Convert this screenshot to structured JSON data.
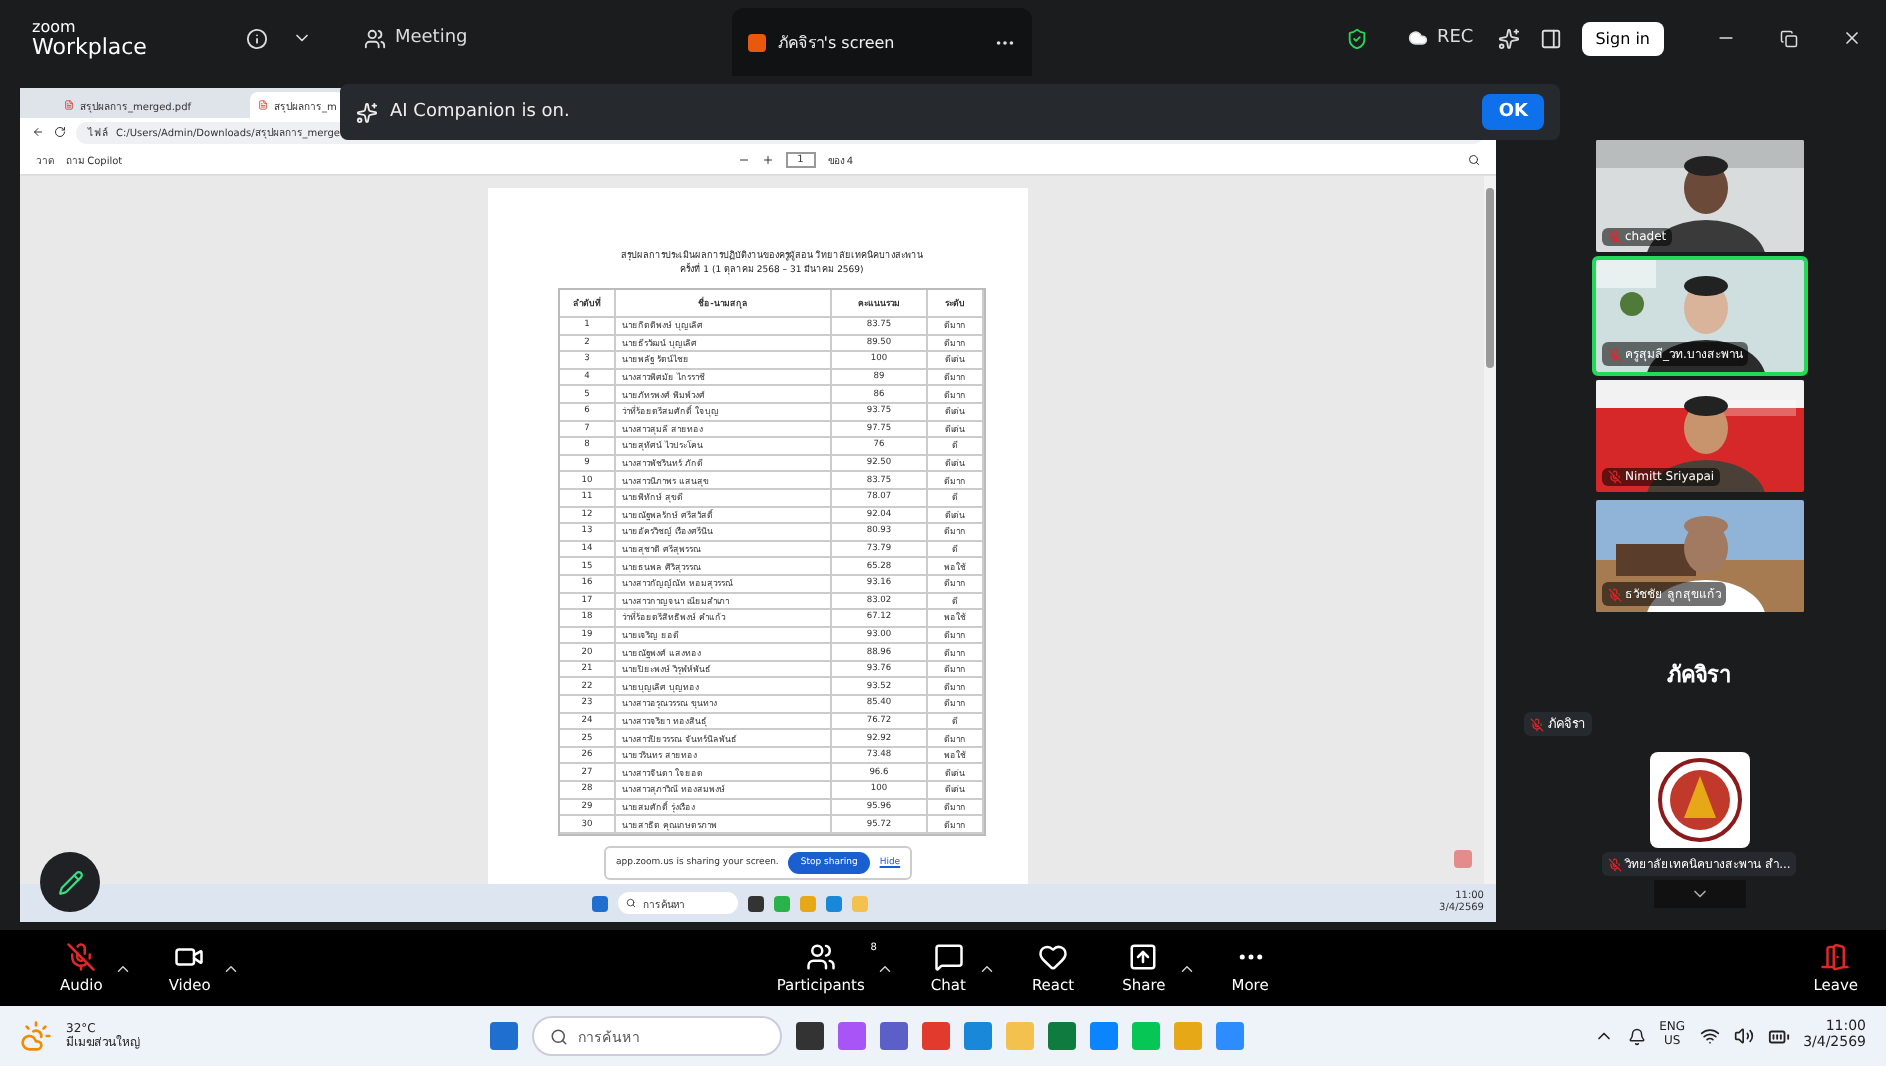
{
  "top_bar": {
    "logo_top": "zoom",
    "logo_bottom": "Workplace",
    "meeting_label": "Meeting",
    "share_tab": "ภัคจิรา's screen",
    "rec_label": "REC",
    "sign_in": "Sign in"
  },
  "ai_banner": {
    "message": "AI Companion is on.",
    "button": "OK"
  },
  "shared_screen": {
    "browser_tabs": [
      {
        "title": "สรุปผลการ_merged.pdf",
        "selected": false
      },
      {
        "title": "สรุปผลการ_m",
        "selected": true
      }
    ],
    "address": {
      "scheme": "ไฟล์",
      "path": "C:/Users/Admin/Downloads/สรุปผลการ_merge"
    },
    "pdf_toolbar": {
      "draw": "วาด",
      "copilot": "ถาม Copilot",
      "page": "1",
      "page_total": "ของ 4"
    },
    "document": {
      "title": "สรุปผลการประเมินผลการปฏิบัติงานของครูผู้สอน วิทยาลัยเทคนิคบางสะพาน",
      "subtitle": "ครั้งที่ 1 (1 ตุลาคม 2568 – 31 มีนาคม 2569)",
      "columns": [
        "ลำดับที่",
        "ชื่อ-นามสกุล",
        "คะแนนรวม",
        "ระดับ"
      ],
      "rows": [
        [
          "1",
          "นายกิตติพงษ์ บุญเลิศ",
          "83.75",
          "ดีมาก"
        ],
        [
          "2",
          "นายธีรวัฒน์ บุญเลิศ",
          "89.50",
          "ดีมาก"
        ],
        [
          "3",
          "นายพลัฐ รัตน์ไชย",
          "100",
          "ดีเด่น"
        ],
        [
          "4",
          "นางสาวพิศมัย ไกรราชี",
          "89",
          "ดีมาก"
        ],
        [
          "5",
          "นายภัทรพงศ์ พิมพ์วงศ์",
          "86",
          "ดีมาก"
        ],
        [
          "6",
          "ว่าที่ร้อยตรีสมศักดิ์ ใจบุญ",
          "93.75",
          "ดีเด่น"
        ],
        [
          "7",
          "นางสาวสุมลี สายทอง",
          "97.75",
          "ดีเด่น"
        ],
        [
          "8",
          "นายสุทัศน์ ไวประโคน",
          "76",
          "ดี"
        ],
        [
          "9",
          "นางสาวพัชรินทร์ ภักดี",
          "92.50",
          "ดีเด่น"
        ],
        [
          "10",
          "นางสาวนิภาพร แสนสุข",
          "83.75",
          "ดีมาก"
        ],
        [
          "11",
          "นายพิทักษ์ สุขดี",
          "78.07",
          "ดี"
        ],
        [
          "12",
          "นายณัฐพลรักษ์ ศรีสวัสดิ์",
          "92.04",
          "ดีเด่น"
        ],
        [
          "13",
          "นายอัครวิชญ์ เรืองศรีนิน",
          "80.93",
          "ดีมาก"
        ],
        [
          "14",
          "นายสุชาติ ศรีสุพรรณ",
          "73.79",
          "ดี"
        ],
        [
          "15",
          "นายธนพล ศิริสุวรรณ",
          "65.28",
          "พอใช้"
        ],
        [
          "16",
          "นางสาวกัญญ์ณัท หอมสุวรรณ์",
          "93.16",
          "ดีมาก"
        ],
        [
          "17",
          "นางสาวกาญจนา เนียมสำเภา",
          "83.02",
          "ดี"
        ],
        [
          "18",
          "ว่าที่ร้อยตรีสิทธิพงษ์ คำแก้ว",
          "67.12",
          "พอใช้"
        ],
        [
          "19",
          "นายเจริญ ยอดี",
          "93.00",
          "ดีมาก"
        ],
        [
          "20",
          "นายณัฐพงศ์ แสงทอง",
          "88.96",
          "ดีมาก"
        ],
        [
          "21",
          "นายปิยะพงษ์ วิรุฬห์พันธ์",
          "93.76",
          "ดีมาก"
        ],
        [
          "22",
          "นายบุญเลิศ บุญทอง",
          "93.52",
          "ดีมาก"
        ],
        [
          "23",
          "นางสาวอรุณวรรณ ขุนทาง",
          "85.40",
          "ดีมาก"
        ],
        [
          "24",
          "นางสาวจริยา ทองสินธุ์",
          "76.72",
          "ดี"
        ],
        [
          "25",
          "นางสาวปิยวรรณ จันทร์นิลพันธ์",
          "92.92",
          "ดีมาก"
        ],
        [
          "26",
          "นายวรินทร สายทอง",
          "73.48",
          "พอใช้"
        ],
        [
          "27",
          "นางสาวจินดา ใจยอด",
          "96.6",
          "ดีเด่น"
        ],
        [
          "28",
          "นางสาวสุภาวิณี ทองสมพงษ์",
          "100",
          "ดีเด่น"
        ],
        [
          "29",
          "นายสมศักดิ์ รุ่งเรือง",
          "95.96",
          "ดีมาก"
        ],
        [
          "30",
          "นายสาธิต คุณเกษตรภาพ",
          "95.72",
          "ดีมาก"
        ]
      ]
    },
    "sharing_bar": {
      "message": "app.zoom.us is sharing your screen.",
      "stop": "Stop sharing",
      "hide": "Hide"
    },
    "taskbar": {
      "search": "การค้นหา",
      "time": "11:00",
      "date": "3/4/2569"
    }
  },
  "gallery": {
    "tiles": [
      {
        "name": "chadet",
        "muted": true,
        "speaking": false
      },
      {
        "name": "ครูสุมลี_วท.บางสะพาน",
        "muted": true,
        "speaking": true
      },
      {
        "name": "Nimitt Sriyapai",
        "muted": true,
        "speaking": false
      },
      {
        "name": "ธวัชชัย ลูกสุขแก้ว",
        "muted": true,
        "speaking": false
      }
    ],
    "presenter": "ภัคจิรา",
    "presenter_tag": {
      "name": "ภัคจิรา",
      "muted": true
    },
    "logo_tile": {
      "name": "วิทยาลัยเทคนิคบางสะพาน สำ...",
      "muted": true
    }
  },
  "toolbar": {
    "items": [
      {
        "kind": "audio",
        "label": "Audio",
        "muted": true
      },
      {
        "kind": "video",
        "label": "Video"
      },
      {
        "kind": "participants",
        "label": "Participants",
        "count": "8"
      },
      {
        "kind": "chat",
        "label": "Chat"
      },
      {
        "kind": "react",
        "label": "React"
      },
      {
        "kind": "share",
        "label": "Share"
      },
      {
        "kind": "more",
        "label": "More"
      }
    ],
    "leave": "Leave"
  },
  "taskbar": {
    "temperature": "32°C",
    "weather": "มีเมฆส่วนใหญ่",
    "search": "การค้นหา",
    "language": "ENG",
    "region": "US",
    "time": "11:00",
    "date": "3/4/2569"
  }
}
